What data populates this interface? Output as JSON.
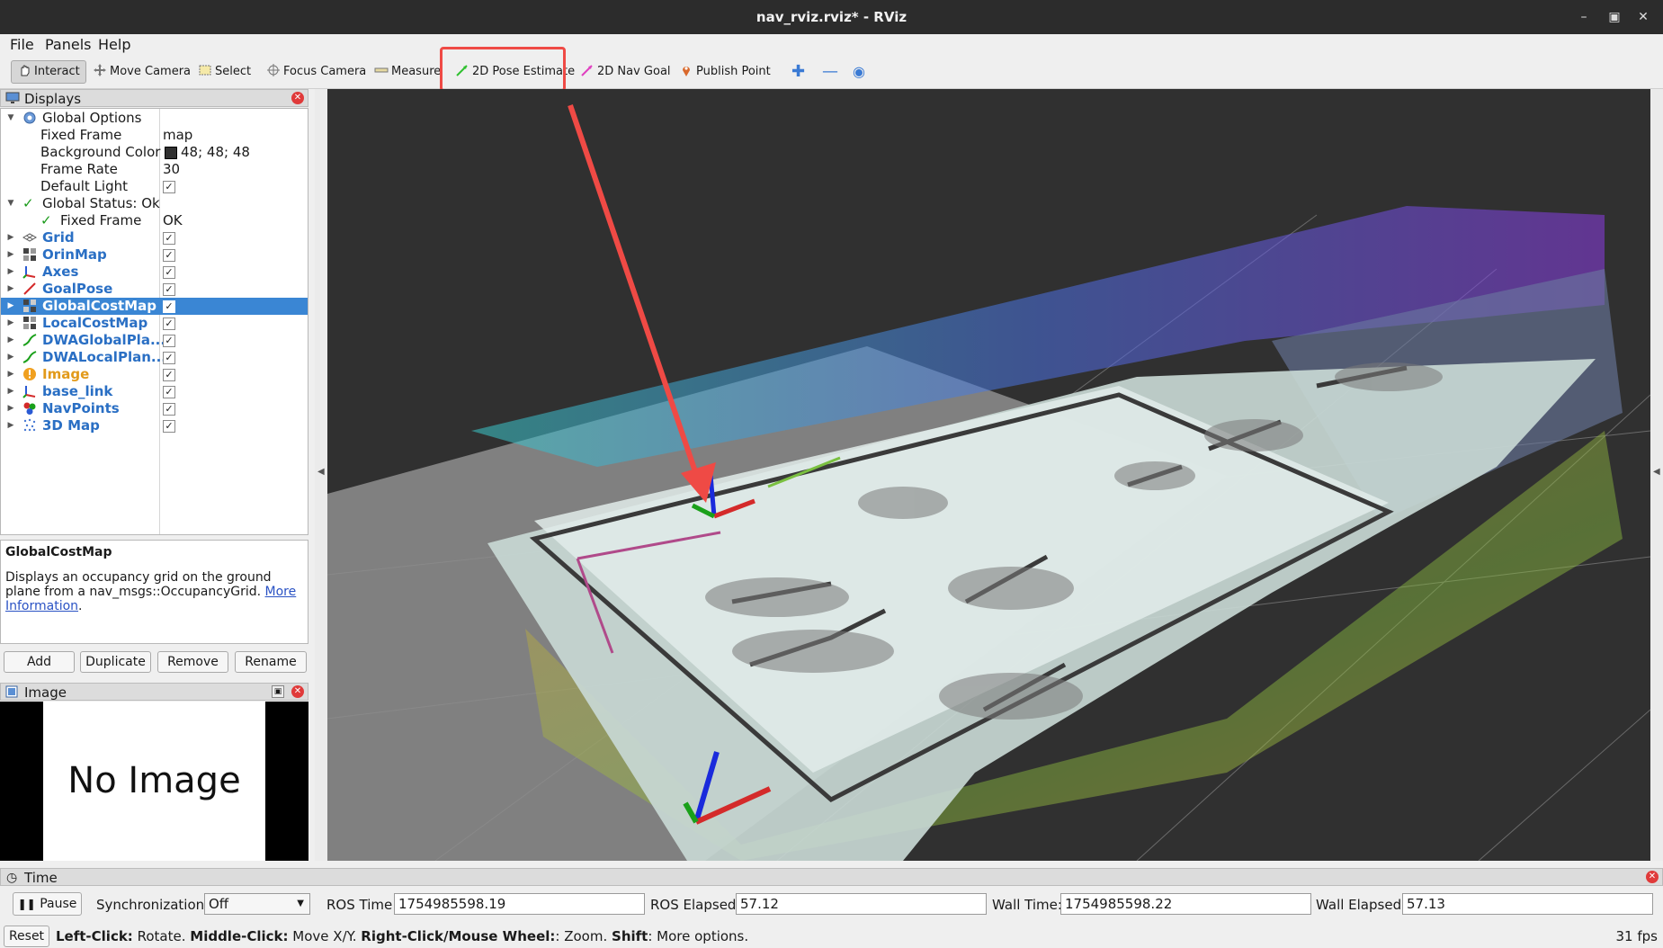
{
  "window": {
    "title": "nav_rviz.rviz* - RViz"
  },
  "menu": {
    "file": "File",
    "panels": "Panels",
    "help": "Help"
  },
  "toolbar": {
    "interact": "Interact",
    "move_camera": "Move Camera",
    "select": "Select",
    "focus_camera": "Focus Camera",
    "measure": "Measure",
    "pose_estimate": "2D Pose Estimate",
    "nav_goal": "2D Nav Goal",
    "publish_point": "Publish Point"
  },
  "displays": {
    "title": "Displays",
    "global_options": "Global Options",
    "fixed_frame_label": "Fixed Frame",
    "fixed_frame_value": "map",
    "background_color_label": "Background Color",
    "background_color_value": "48; 48; 48",
    "frame_rate_label": "Frame Rate",
    "frame_rate_value": "30",
    "default_light_label": "Default Light",
    "global_status": "Global Status: Ok",
    "status_fixed_frame_label": "Fixed Frame",
    "status_fixed_frame_value": "OK",
    "items": [
      {
        "label": "Grid"
      },
      {
        "label": "OrinMap"
      },
      {
        "label": "Axes"
      },
      {
        "label": "GoalPose"
      },
      {
        "label": "GlobalCostMap"
      },
      {
        "label": "LocalCostMap"
      },
      {
        "label": "DWAGlobalPla..."
      },
      {
        "label": "DWALocalPlan..."
      },
      {
        "label": "Image"
      },
      {
        "label": "base_link"
      },
      {
        "label": "NavPoints"
      },
      {
        "label": "3D Map"
      }
    ]
  },
  "description": {
    "title": "GlobalCostMap",
    "text": "Displays an occupancy grid on the ground plane from a nav_msgs::OccupancyGrid.",
    "link": "More Information",
    "period": "."
  },
  "buttons": {
    "add": "Add",
    "duplicate": "Duplicate",
    "remove": "Remove",
    "rename": "Rename"
  },
  "image_panel": {
    "title": "Image",
    "placeholder": "No Image"
  },
  "time": {
    "title": "Time",
    "pause": "Pause",
    "sync_label": "Synchronization:",
    "sync_value": "Off",
    "ros_time_label": "ROS Time:",
    "ros_time": "1754985598.19",
    "ros_elapsed_label": "ROS Elapsed:",
    "ros_elapsed": "57.12",
    "wall_time_label": "Wall Time:",
    "wall_time": "1754985598.22",
    "wall_elapsed_label": "Wall Elapsed:",
    "wall_elapsed": "57.13"
  },
  "status": {
    "reset": "Reset",
    "left_click": "Left-Click:",
    "left_click_desc": "Rotate.",
    "middle_click": "Middle-Click:",
    "middle_click_desc": "Move X/Y.",
    "right_click": "Right-Click/Mouse Wheel:",
    "right_click_desc": ": Zoom.",
    "shift": "Shift",
    "shift_desc": ": More options.",
    "fps": "31 fps"
  },
  "colors": {
    "accent": "#3a86d4",
    "highlight": "#ef4a45",
    "viewport_bg": "#303030"
  }
}
